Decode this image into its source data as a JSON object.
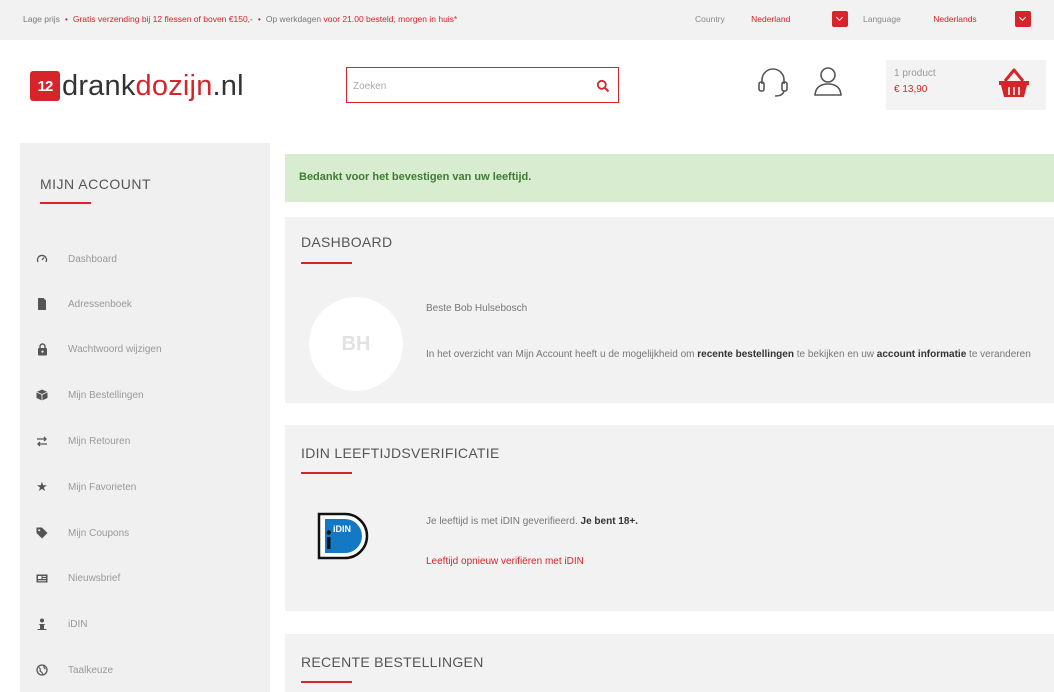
{
  "topbar": {
    "usp_1": "Lage prijs",
    "usp_2": "Gratis verzending bij 12 flessen of boven €150,-",
    "usp_3_prefix": "Op werkdagen ",
    "usp_3_red": "voor 21.00 besteld, morgen in huis*",
    "separator": "•",
    "country_label": "Country",
    "country_value": "Nederland",
    "language_label": "Language",
    "language_value": "Nederlands"
  },
  "header": {
    "logo_badge": "12",
    "logo_text_1": "drank",
    "logo_text_2": "dozijn",
    "logo_text_3": ".nl",
    "search_placeholder": "Zoeken",
    "cart_count": "1 product",
    "cart_price": "€ 13,90"
  },
  "sidebar": {
    "title": "MIJN ACCOUNT",
    "items": [
      {
        "label": "Dashboard",
        "icon": "dashboard-icon"
      },
      {
        "label": "Adressenboek",
        "icon": "document-icon"
      },
      {
        "label": "Wachtwoord wijzigen",
        "icon": "lock-icon"
      },
      {
        "label": "Mijn Bestellingen",
        "icon": "box-icon"
      },
      {
        "label": "Mijn Retouren",
        "icon": "exchange-icon"
      },
      {
        "label": "Mijn Favorieten",
        "icon": "star-icon"
      },
      {
        "label": "Mijn Coupons",
        "icon": "tag-icon"
      },
      {
        "label": "Nieuwsbrief",
        "icon": "newspaper-icon"
      },
      {
        "label": "iDIN",
        "icon": "person-icon"
      },
      {
        "label": "Taalkeuze",
        "icon": "globe-icon"
      }
    ]
  },
  "alert": {
    "text": "Bedankt voor het bevestigen van uw leeftijd."
  },
  "dashboard": {
    "title": "DASHBOARD",
    "avatar_text": "BH",
    "greeting": "Beste Bob Hulsebosch",
    "intro_1": "In het overzicht van Mijn Account heeft u de mogelijkheid om ",
    "intro_bold_1": "recente bestellingen",
    "intro_2": " te bekijken en uw ",
    "intro_bold_2": "account informatie",
    "intro_3": " te veranderen"
  },
  "idin": {
    "title": "IDIN LEEFTIJDSVERIFICATIE",
    "logo_text": "iDIN",
    "status_prefix": "Je leeftijd is met iDIN geverifieerd. ",
    "status_bold": "Je bent 18+.",
    "reverify_link": "Leeftijd opnieuw verifiëren met iDIN"
  },
  "recent": {
    "title": "RECENTE BESTELLINGEN"
  },
  "colors": {
    "accent": "#d6242b",
    "alert_bg": "#d8eccf",
    "alert_text": "#3e7c35",
    "panel_bg": "#f2f2f2"
  }
}
